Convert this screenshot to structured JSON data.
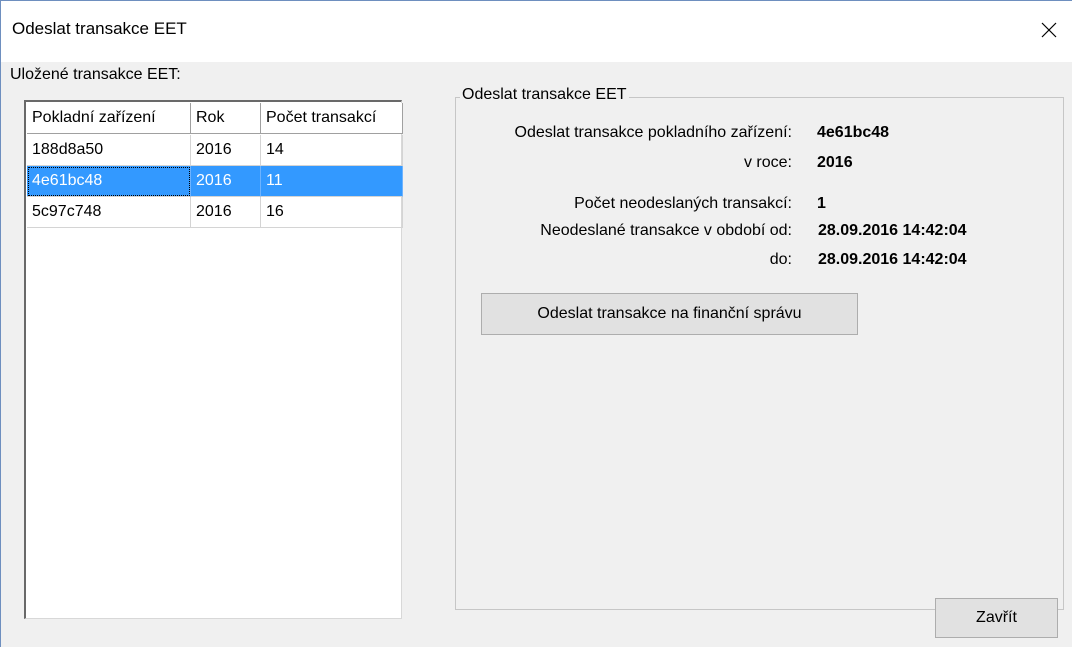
{
  "window": {
    "title": "Odeslat transakce EET",
    "close_icon": "close-icon"
  },
  "saved": {
    "label": "Uložené transakce EET:",
    "columns": [
      "Pokladní zařízení",
      "Rok",
      "Počet transakcí"
    ],
    "rows": [
      {
        "device": "188d8a50",
        "year": "2016",
        "count": "14"
      },
      {
        "device": "4e61bc48",
        "year": "2016",
        "count": "11"
      },
      {
        "device": "5c97c748",
        "year": "2016",
        "count": "16"
      }
    ],
    "selected_index": 1
  },
  "details": {
    "group_title": "Odeslat transakce EET",
    "device_label": "Odeslat transakce pokladního zařízení:",
    "device_value": "4e61bc48",
    "year_label": "v roce:",
    "year_value": "2016",
    "unsent_count_label": "Počet neodeslaných transakcí:",
    "unsent_count_value": "1",
    "period_from_label": "Neodeslané transakce v období od:",
    "period_from_value": "28.09.2016 14:42:04",
    "period_to_label": "do:",
    "period_to_value": "28.09.2016 14:42:04",
    "send_button": "Odeslat transakce na finanční správu"
  },
  "footer": {
    "close_button": "Zavřít"
  },
  "colors": {
    "selection": "#3399ff",
    "window_bg": "#f0f0f0"
  }
}
